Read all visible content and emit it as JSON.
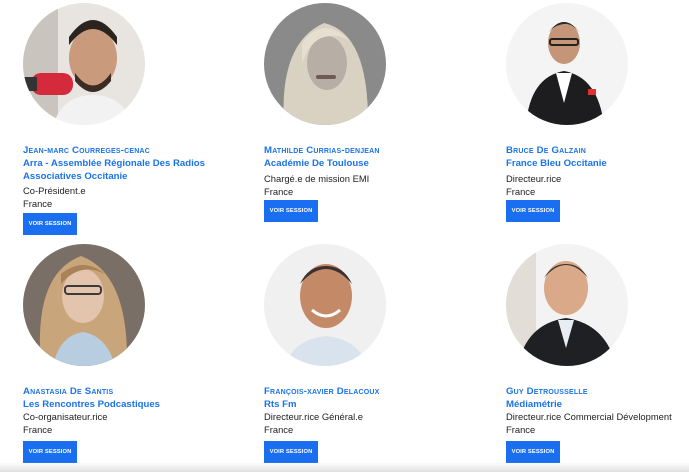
{
  "button_label": "VOIR SESSION",
  "speakers": [
    {
      "name": "Jean-marc Courreges-cenac",
      "org": "Arra - Assemblée Régionale Des Radios Associatives Occitanie",
      "role": "Co-Président.e",
      "country": "France"
    },
    {
      "name": "Mathilde Currias-denjean",
      "org": "Académie De Toulouse",
      "role": "Chargé.e de mission EMI",
      "country": "France"
    },
    {
      "name": "Bruce De Galzain",
      "org": "France Bleu Occitanie",
      "role": "Directeur.rice",
      "country": "France"
    },
    {
      "name": "Anastasia De Santis",
      "org": "Les Rencontres Podcastiques",
      "role": "Co-organisateur.rice",
      "country": "France"
    },
    {
      "name": "François-xavier Delacoux",
      "org": "Rts Fm",
      "role": "Directeur.rice Général.e",
      "country": "France"
    },
    {
      "name": "Guy Detrousselle",
      "org": "Médiamétrie",
      "role": "Directeur.rice Commercial Dévelopment",
      "country": "France"
    }
  ]
}
